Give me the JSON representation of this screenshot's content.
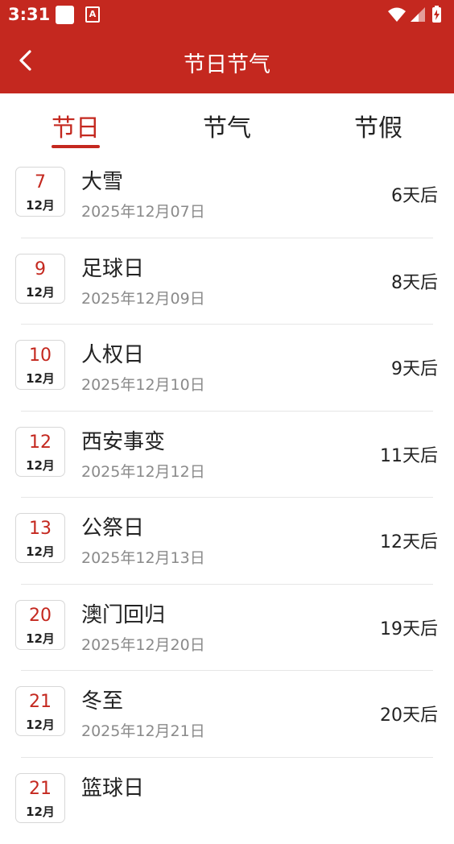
{
  "status_bar": {
    "time": "3:31",
    "notif_icon_letter": "A"
  },
  "app_bar": {
    "title": "节日节气"
  },
  "tabs": [
    {
      "label": "节日",
      "active": true
    },
    {
      "label": "节气",
      "active": false
    },
    {
      "label": "节假",
      "active": false
    }
  ],
  "items": [
    {
      "day": "7",
      "month": "12月",
      "name": "大雪",
      "date": "2025年12月07日",
      "countdown": "6天后"
    },
    {
      "day": "9",
      "month": "12月",
      "name": "足球日",
      "date": "2025年12月09日",
      "countdown": "8天后"
    },
    {
      "day": "10",
      "month": "12月",
      "name": "人权日",
      "date": "2025年12月10日",
      "countdown": "9天后"
    },
    {
      "day": "12",
      "month": "12月",
      "name": "西安事变",
      "date": "2025年12月12日",
      "countdown": "11天后"
    },
    {
      "day": "13",
      "month": "12月",
      "name": "公祭日",
      "date": "2025年12月13日",
      "countdown": "12天后"
    },
    {
      "day": "20",
      "month": "12月",
      "name": "澳门回归",
      "date": "2025年12月20日",
      "countdown": "19天后"
    },
    {
      "day": "21",
      "month": "12月",
      "name": "冬至",
      "date": "2025年12月21日",
      "countdown": "20天后"
    },
    {
      "day": "21",
      "month": "12月",
      "name": "篮球日",
      "date": "",
      "countdown": ""
    }
  ],
  "colors": {
    "accent": "#c4281f",
    "secondary_text": "#8a8a8a",
    "divider": "#e6e6e6"
  }
}
